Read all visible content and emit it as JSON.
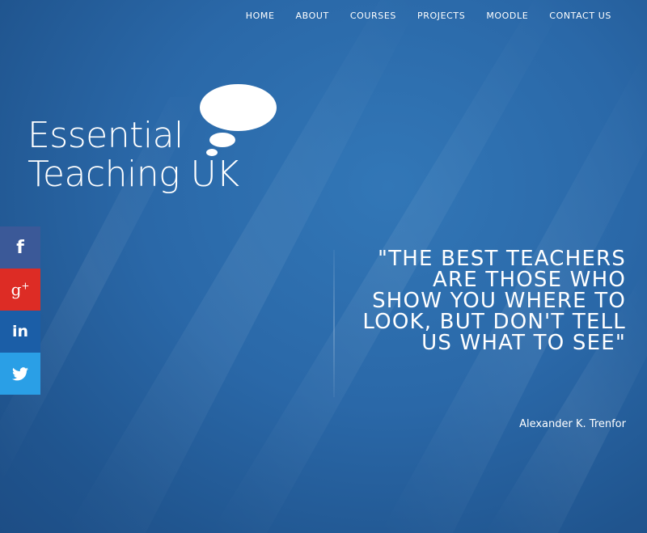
{
  "nav": {
    "items": [
      {
        "label": "HOME"
      },
      {
        "label": "ABOUT"
      },
      {
        "label": "COURSES"
      },
      {
        "label": "PROJECTS"
      },
      {
        "label": "MOODLE"
      },
      {
        "label": "CONTACT US"
      }
    ]
  },
  "logo": {
    "line1": "Essential",
    "line2": "Teaching UK"
  },
  "social": {
    "facebook": {
      "glyph": "f",
      "color": "#3b5998"
    },
    "google_plus": {
      "glyph": "g",
      "sup": "+",
      "color": "#dd2c25"
    },
    "linkedin": {
      "glyph": "in",
      "color": "#1b5ea7"
    },
    "twitter": {
      "icon": "twitter-bird-icon",
      "color": "#2a9fe6"
    }
  },
  "quote": {
    "text": "\"THE BEST TEACHERS ARE THOSE WHO SHOW YOU WHERE TO LOOK, BUT DON'T TELL US WHAT TO SEE\"",
    "author": "Alexander K. Trenfor"
  },
  "colors": {
    "background": "#2a68a8",
    "text": "#ffffff"
  }
}
